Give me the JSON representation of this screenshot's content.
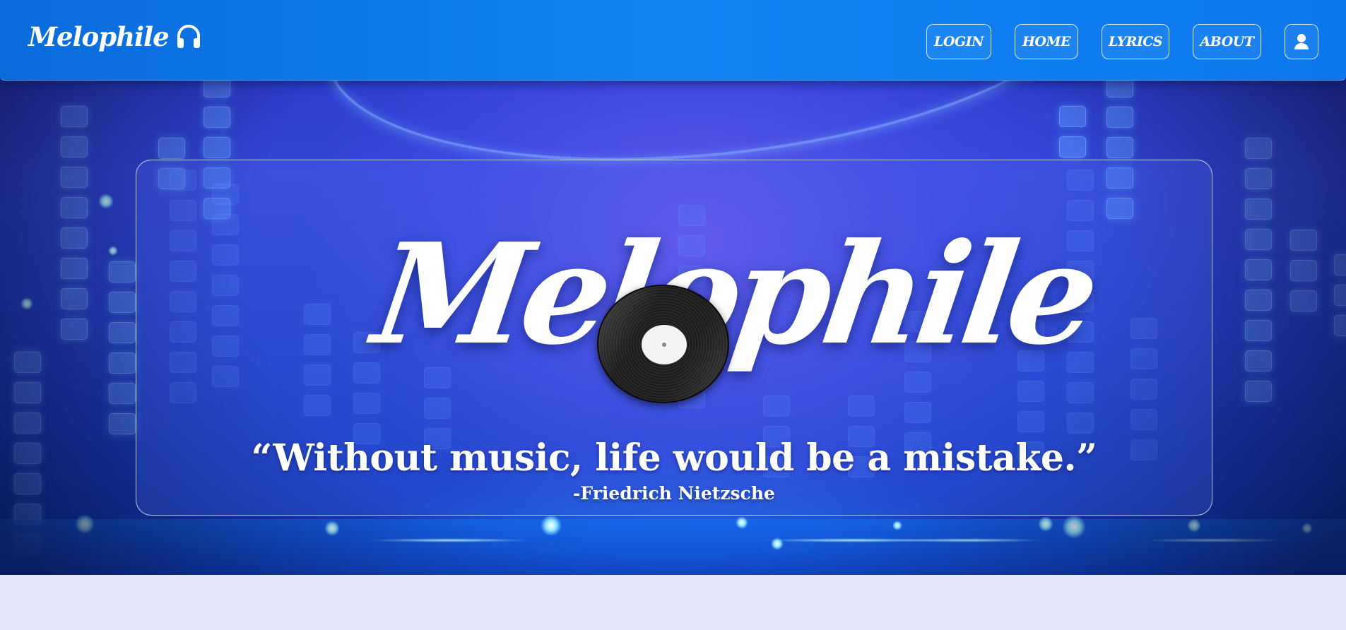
{
  "app": {
    "brand_name": "Melophile",
    "brand_icon": "headphones-icon",
    "accent_color": "#0f7cf0",
    "page_background": "#e6e6fc"
  },
  "nav": {
    "items": [
      {
        "label": "LOGIN"
      },
      {
        "label": "HOME"
      },
      {
        "label": "LYRICS"
      },
      {
        "label": "ABOUT"
      }
    ],
    "user_icon": "user-icon"
  },
  "hero": {
    "logo_text": "Melophile",
    "logo_icon": "vinyl-record-icon",
    "quote": "“Without music, life would be a mistake.”",
    "quote_author": "-Friedrich Nietzsche"
  }
}
